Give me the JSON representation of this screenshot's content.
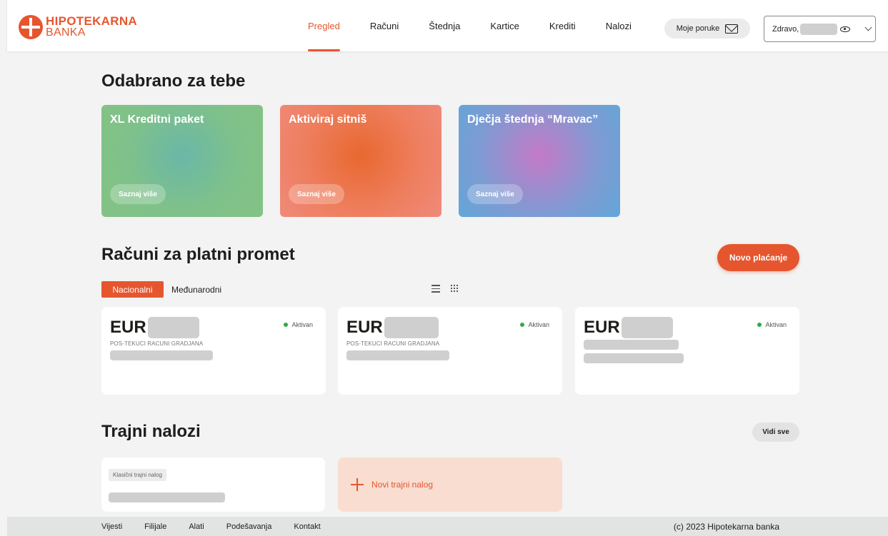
{
  "brand": {
    "name_line1": "HIPOTEKARNA",
    "name_line2": "BANKA",
    "accent_color": "#e5562f"
  },
  "nav": {
    "items": [
      {
        "label": "Pregled",
        "active": true
      },
      {
        "label": "Računi",
        "active": false
      },
      {
        "label": "Štednja",
        "active": false
      },
      {
        "label": "Kartice",
        "active": false
      },
      {
        "label": "Krediti",
        "active": false
      },
      {
        "label": "Nalozi",
        "active": false
      }
    ]
  },
  "header": {
    "messages_label": "Moje poruke",
    "greeting": "Zdravo,"
  },
  "promos": {
    "title": "Odabrano za tebe",
    "cards": [
      {
        "title": "XL Kreditni paket",
        "button": "Saznaj više"
      },
      {
        "title": "Aktiviraj sitniš",
        "button": "Saznaj više"
      },
      {
        "title": "Dječja štednja “Mravac”",
        "button": "Saznaj više"
      }
    ]
  },
  "accounts": {
    "title": "Računi za platni promet",
    "new_payment": "Novo plaćanje",
    "tabs": [
      {
        "label": "Nacionalni",
        "active": true
      },
      {
        "label": "Međunarodni",
        "active": false
      }
    ],
    "cards": [
      {
        "currency": "EUR",
        "status": "Aktivan",
        "type": "POS-TEKUCI RACUNI GRADJANA"
      },
      {
        "currency": "EUR",
        "status": "Aktivan",
        "type": "POS-TEKUCI RACUNI GRADJANA"
      },
      {
        "currency": "EUR",
        "status": "Aktivan",
        "type": ""
      }
    ]
  },
  "standing_orders": {
    "title": "Trajni nalozi",
    "see_all": "Vidi sve",
    "order_tag": "Klasični trajni nalog",
    "new_order": "Novi trajni nalog"
  },
  "footer": {
    "links": [
      "Vijesti",
      "Filijale",
      "Alati",
      "Podešavanja",
      "Kontakt"
    ],
    "copyright": "(c) 2023 Hipotekarna banka"
  }
}
